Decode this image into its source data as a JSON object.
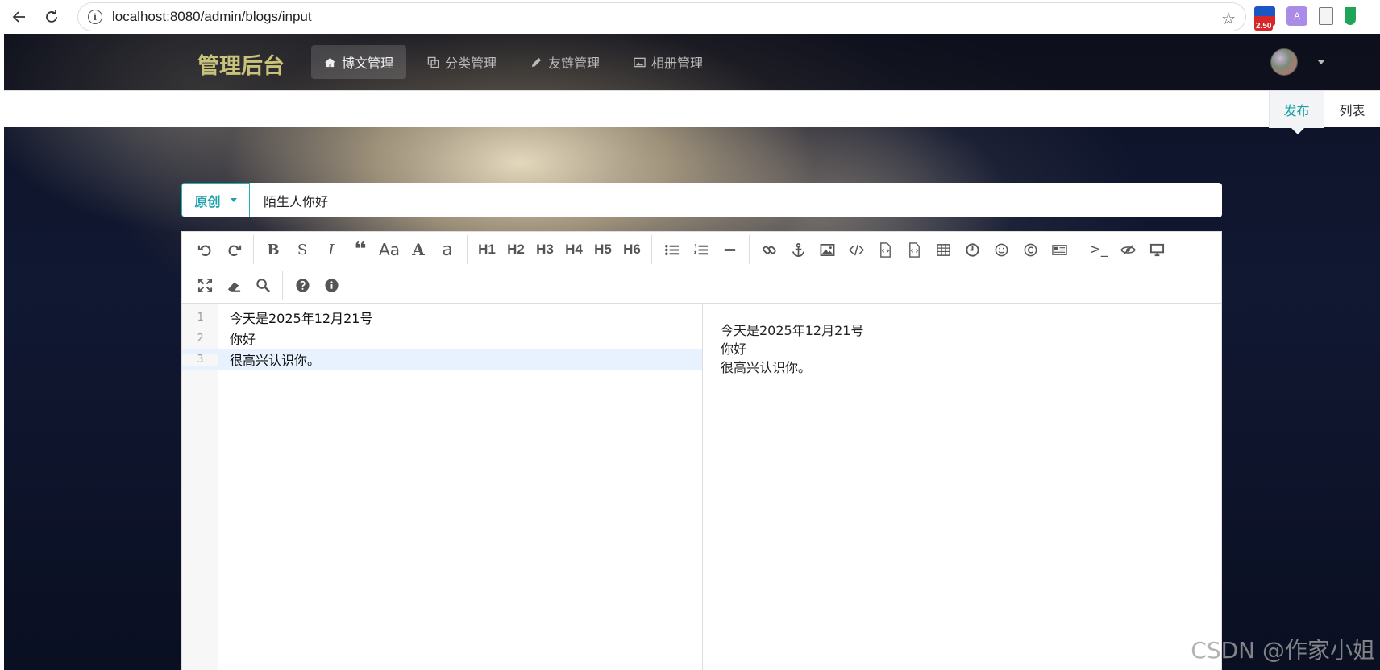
{
  "browser": {
    "url": "localhost:8080/admin/blogs/input",
    "ext_badge": "2.50",
    "ext_translate": "A"
  },
  "nav": {
    "brand": "管理后台",
    "items": [
      {
        "label": "博文管理",
        "icon": "home-icon",
        "active": true
      },
      {
        "label": "分类管理",
        "icon": "copy-icon",
        "active": false
      },
      {
        "label": "友链管理",
        "icon": "pencil-icon",
        "active": false
      },
      {
        "label": "相册管理",
        "icon": "image-icon",
        "active": false
      }
    ]
  },
  "subnav": {
    "publish": "发布",
    "list": "列表"
  },
  "editor_form": {
    "type_selected": "原创",
    "title_value": "陌生人你好"
  },
  "toolbar": {
    "bold": "B",
    "strike": "S",
    "italic": "I",
    "uppercase": "Aa",
    "upper_a": "A",
    "lower_a": "a",
    "h1": "H1",
    "h2": "H2",
    "h3": "H3",
    "h4": "H4",
    "h5": "H5",
    "h6": "H6",
    "terminal": ">_"
  },
  "code_lines": [
    {
      "num": "1",
      "text": "今天是2025年12月21号"
    },
    {
      "num": "2",
      "text": "你好"
    },
    {
      "num": "3",
      "text": "很高兴认识你。"
    }
  ],
  "preview_lines": [
    "今天是2025年12月21号",
    "你好",
    "很高兴认识你。"
  ],
  "watermark": "CSDN @作家小姐"
}
